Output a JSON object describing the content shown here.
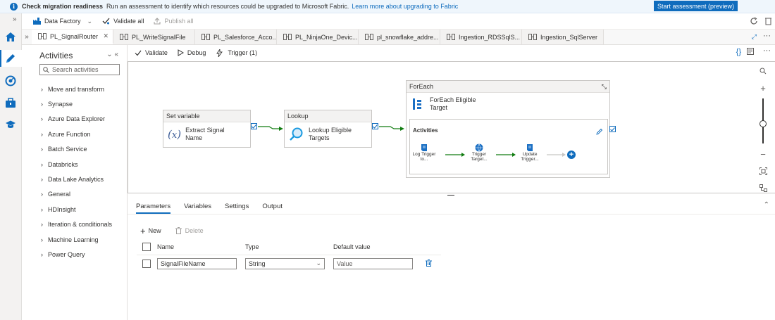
{
  "banner": {
    "title": "Check migration readiness",
    "message": "Run an assessment to identify which resources could be upgraded to Microsoft Fabric.",
    "link": "Learn more about upgrading to Fabric",
    "button": "Start assessment (preview)"
  },
  "toolbar": {
    "factory": "Data Factory",
    "validate_all": "Validate all",
    "publish_all": "Publish all"
  },
  "tabs": [
    {
      "label": "PL_SignalRouter",
      "active": true
    },
    {
      "label": "PL_WriteSignalFile"
    },
    {
      "label": "PL_Salesforce_Acco..."
    },
    {
      "label": "PL_NinjaOne_Devic..."
    },
    {
      "label": "pl_snowflake_addre..."
    },
    {
      "label": "Ingestion_RDSSqlS..."
    },
    {
      "label": "Ingestion_SqlServer"
    }
  ],
  "activities": {
    "title": "Activities",
    "search_placeholder": "Search activities",
    "groups": [
      "Move and transform",
      "Synapse",
      "Azure Data Explorer",
      "Azure Function",
      "Batch Service",
      "Databricks",
      "Data Lake Analytics",
      "General",
      "HDInsight",
      "Iteration & conditionals",
      "Machine Learning",
      "Power Query"
    ]
  },
  "canvas_toolbar": {
    "validate": "Validate",
    "debug": "Debug",
    "trigger": "Trigger (1)"
  },
  "pipeline": {
    "set_variable": {
      "type": "Set variable",
      "name": "Extract Signal Name"
    },
    "lookup": {
      "type": "Lookup",
      "name": "Lookup Eligible Targets"
    },
    "foreach": {
      "type": "ForEach",
      "name": "ForEach Eligible Target",
      "activities_label": "Activities",
      "inner": [
        {
          "label": "Log Trigger to..."
        },
        {
          "label": "Trigger Target..."
        },
        {
          "label": "Update Trigger..."
        }
      ]
    }
  },
  "panel": {
    "tabs": [
      "Parameters",
      "Variables",
      "Settings",
      "Output"
    ],
    "new": "New",
    "delete": "Delete",
    "columns": {
      "name": "Name",
      "type": "Type",
      "default": "Default value"
    },
    "row": {
      "name": "SignalFileName",
      "type": "String",
      "default_placeholder": "Value"
    }
  },
  "colors": {
    "accent": "#0f6cbd",
    "success": "#107c10"
  }
}
